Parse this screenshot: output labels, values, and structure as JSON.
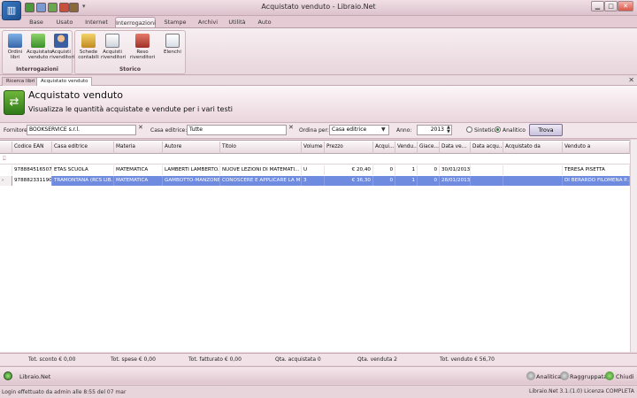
{
  "window": {
    "title": "Acquistato venduto - Libraio.Net"
  },
  "ribbon_tabs": [
    "Base",
    "Usato",
    "Internet",
    "Interrogazioni",
    "Stampe",
    "Archivi",
    "Utilità",
    "Auto"
  ],
  "ribbon": {
    "group1": {
      "name": "Interrogazioni",
      "buttons": [
        {
          "label": "Ordini libri",
          "icon": "search-books-icon"
        },
        {
          "label": "Acquistato venduto",
          "icon": "cart-books-icon"
        },
        {
          "label": "Acquisti rivenditori",
          "icon": "user-icon"
        }
      ]
    },
    "group2": {
      "name": "Storico",
      "buttons": [
        {
          "label": "Schede contabili",
          "icon": "ledger-icon"
        },
        {
          "label": "Acquisti rivenditori",
          "icon": "document-icon"
        },
        {
          "label": "Reso rivenditori",
          "icon": "return-books-icon"
        },
        {
          "label": "Elenchi",
          "icon": "list-pen-icon"
        }
      ]
    }
  },
  "doc_tabs": [
    "Ricerca libri",
    "Acquistato venduto"
  ],
  "header": {
    "title": "Acquistato venduto",
    "subtitle": "Visualizza le quantità acquistate e vendute per i vari testi"
  },
  "filters": {
    "fornitore_label": "Fornitore:",
    "fornitore_value": "BOOKSERVICE s.r.l.",
    "casa_label": "Casa editrice:",
    "casa_value": "Tutte",
    "ordina_label": "Ordina per:",
    "ordina_value": "Casa editrice",
    "anno_label": "Anno:",
    "anno_value": "2013",
    "sintetico_label": "Sintetico",
    "analitico_label": "Analitico",
    "trova_label": "Trova"
  },
  "grid": {
    "columns": [
      "Codice EAN",
      "Casa editrice",
      "Materia",
      "Autore",
      "Titolo",
      "Volume",
      "Prezzo",
      "Acqui...",
      "Vendu...",
      "Giace...",
      "Data ve...",
      "Data acqu...",
      "Acquistato da",
      "Venduto a"
    ],
    "rows": [
      [
        "9788845165078",
        "ETAS SCUOLA",
        "MATEMATICA",
        "LAMBERTI LAMBERTO...",
        "NUOVE LEZIONI DI  MATEMATI...",
        "U",
        "€ 20,40",
        "0",
        "1",
        "0",
        "30/01/2013",
        "",
        "",
        "TERESA PISETTA"
      ],
      [
        "9788823311909",
        "TRAMONTANA (RCS LIB...",
        "MATEMATICA",
        "GAMBOTTO-MANZONE",
        "CONOSCERE E APPLICARE LA M...",
        "3",
        "€ 36,30",
        "0",
        "1",
        "0",
        "28/01/2013",
        "",
        "",
        "DI BERARDO FILOMENA P..."
      ]
    ]
  },
  "summary": {
    "sconto": "Tot. sconto € 0,00",
    "spese": "Tot. spese € 0,00",
    "fatturato": "Tot. fatturato € 0,00",
    "qta_acq": "Qta. acquistata 0",
    "qta_vend": "Qta. venduta 2",
    "tot_venduto": "Tot. venduto € 56,70"
  },
  "bottom": {
    "app_label": "Libraio.Net",
    "analitica": "Analitica",
    "raggruppata": "Raggruppata",
    "chiudi": "Chiudi"
  },
  "status": {
    "left": "Login effettuato da admin alle 8:55 del 07 mar",
    "right": "Libraio.Net 3.1.(1.0) Licenza COMPLETA"
  }
}
